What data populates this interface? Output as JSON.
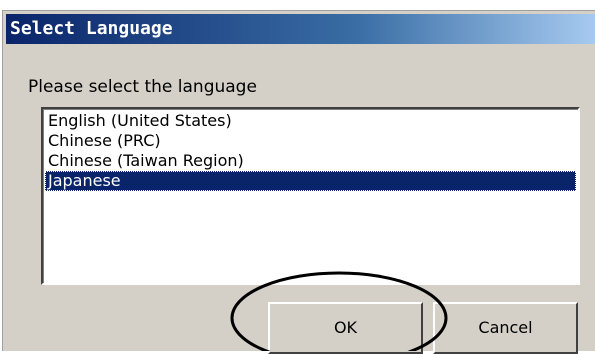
{
  "window": {
    "title": "Select Language"
  },
  "prompt": "Please select the language",
  "languages": {
    "items": [
      {
        "label": "English (United States)",
        "selected": false
      },
      {
        "label": "Chinese (PRC)",
        "selected": false
      },
      {
        "label": "Chinese (Taiwan Region)",
        "selected": false
      },
      {
        "label": "Japanese",
        "selected": true
      }
    ]
  },
  "buttons": {
    "ok_label": "OK",
    "cancel_label": "Cancel"
  },
  "annotation": {
    "shape": "ellipse",
    "target": "ok-button",
    "color": "#000000"
  },
  "colors": {
    "dialog_bg": "#d4d0c8",
    "title_bar": "#0a246a",
    "selection": "#0a246a"
  }
}
